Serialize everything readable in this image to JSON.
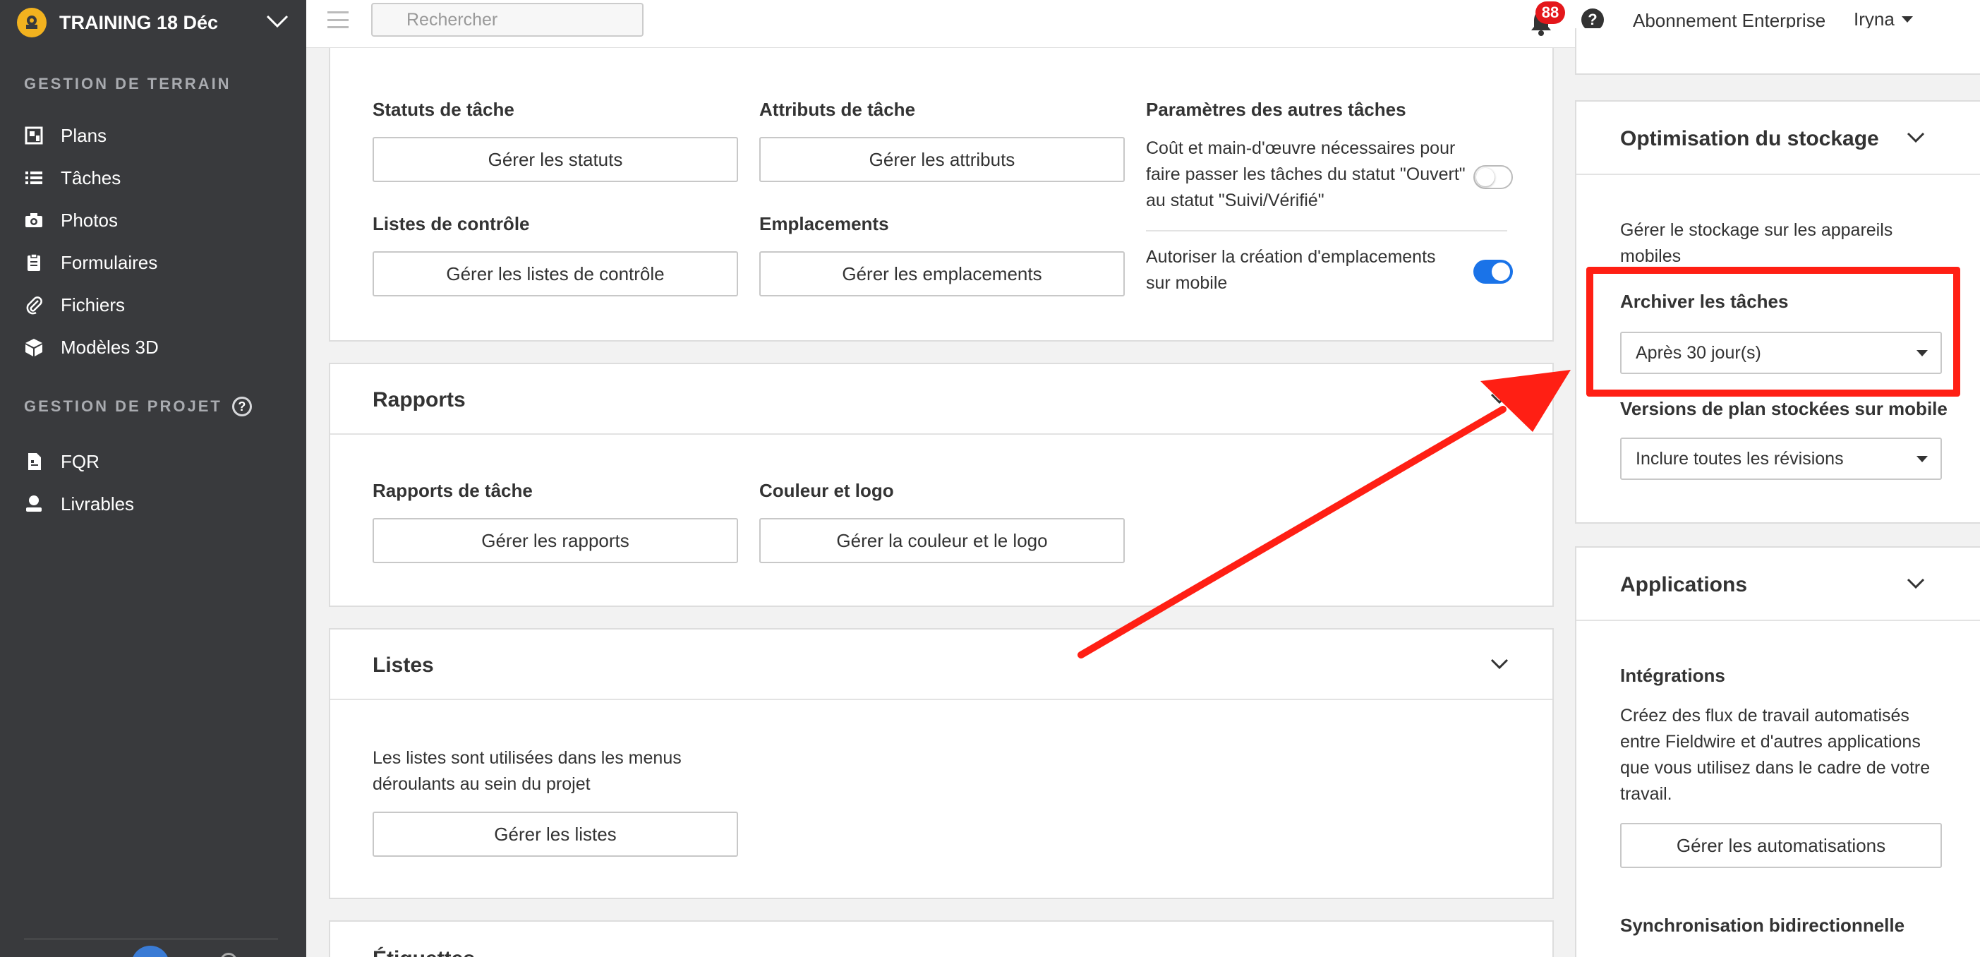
{
  "sidebar": {
    "project_name": "TRAINING 18 Déc",
    "section_field": "GESTION DE TERRAIN",
    "section_project": "GESTION DE PROJET",
    "help_glyph": "?",
    "field_items": [
      {
        "label": "Plans",
        "icon": "plans-icon"
      },
      {
        "label": "Tâches",
        "icon": "list-icon"
      },
      {
        "label": "Photos",
        "icon": "camera-icon"
      },
      {
        "label": "Formulaires",
        "icon": "clipboard-icon"
      },
      {
        "label": "Fichiers",
        "icon": "paperclip-icon"
      },
      {
        "label": "Modèles 3D",
        "icon": "cube-icon"
      }
    ],
    "project_items": [
      {
        "label": "FQR",
        "icon": "document-icon"
      },
      {
        "label": "Livrables",
        "icon": "user-icon"
      }
    ]
  },
  "topbar": {
    "search_placeholder": "Rechercher",
    "notification_count": "88",
    "help_glyph": "?",
    "subscription": "Abonnement Enterprise",
    "user": "Iryna"
  },
  "tasks_card": {
    "statuses_label": "Statuts de tâche",
    "statuses_button": "Gérer les statuts",
    "attributes_label": "Attributs de tâche",
    "attributes_button": "Gérer les attributs",
    "checklists_label": "Listes de contrôle",
    "checklists_button": "Gérer les listes de contrôle",
    "locations_label": "Emplacements",
    "locations_button": "Gérer les emplacements",
    "other_params_label": "Paramètres des autres tâches",
    "cost_line1": "Coût et main-d'œuvre nécessaires pour",
    "cost_line2": "faire passer les tâches du statut \"Ouvert\"",
    "cost_line3": "au statut \"Suivi/Vérifié\"",
    "mobile_locations_line1": "Autoriser la création d'emplacements",
    "mobile_locations_line2": "sur mobile",
    "cost_toggle_on": false,
    "mobile_locations_toggle_on": true
  },
  "reports_card": {
    "title": "Rapports",
    "task_reports_label": "Rapports de tâche",
    "task_reports_button": "Gérer les rapports",
    "color_logo_label": "Couleur et logo",
    "color_logo_button": "Gérer la couleur et le logo"
  },
  "lists_card": {
    "title": "Listes",
    "desc_line1": "Les listes sont utilisées dans les menus",
    "desc_line2": "déroulants au sein du projet",
    "button": "Gérer les listes"
  },
  "tags_card": {
    "title": "Étiquettes"
  },
  "storage_card": {
    "title": "Optimisation du stockage",
    "desc_line1": "Gérer le stockage sur les appareils",
    "desc_line2": "mobiles",
    "archive_label": "Archiver les tâches",
    "archive_value": "Après 30 jour(s)",
    "versions_label": "Versions de plan stockées sur mobile",
    "versions_value": "Inclure toutes les révisions"
  },
  "apps_card": {
    "title": "Applications",
    "integrations_label": "Intégrations",
    "desc_line1": "Créez des flux de travail automatisés",
    "desc_line2": "entre Fieldwire et d'autres applications",
    "desc_line3": "que vous utilisez dans le cadre de votre",
    "desc_line4": "travail.",
    "button": "Gérer les automatisations",
    "sync_label": "Synchronisation bidirectionnelle"
  },
  "colors": {
    "sidebar_bg": "#393a3d",
    "accent_blue": "#1a73e8",
    "annotation_red": "#ff1f14",
    "badge_red": "#e4171b"
  }
}
